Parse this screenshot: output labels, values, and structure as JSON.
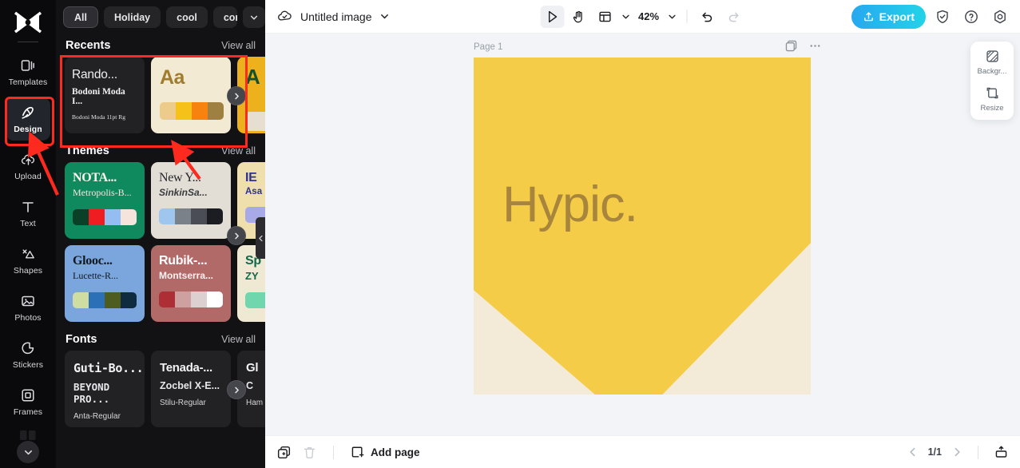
{
  "sidebar": {
    "logo_icon": "capcut-logo-icon",
    "items": [
      {
        "label": "Templates",
        "icon": "templates-icon",
        "active": false
      },
      {
        "label": "Design",
        "icon": "design-icon",
        "active": true
      },
      {
        "label": "Upload",
        "icon": "upload-cloud-icon",
        "active": false
      },
      {
        "label": "Text",
        "icon": "text-icon",
        "active": false
      },
      {
        "label": "Shapes",
        "icon": "shapes-icon",
        "active": false
      },
      {
        "label": "Photos",
        "icon": "photos-icon",
        "active": false
      },
      {
        "label": "Stickers",
        "icon": "stickers-icon",
        "active": false
      },
      {
        "label": "Frames",
        "icon": "frames-icon",
        "active": false
      }
    ],
    "more_icon": "chevron-down-icon"
  },
  "panel": {
    "chips": [
      {
        "label": "All",
        "selected": true
      },
      {
        "label": "Holiday",
        "selected": false
      },
      {
        "label": "cool",
        "selected": false
      },
      {
        "label": "concise",
        "selected": false
      }
    ],
    "chips_expand_icon": "chevron-down-icon",
    "view_all_label": "View all",
    "sections": {
      "recents": {
        "title": "Recents",
        "cards": [
          {
            "kind": "dark",
            "line1": "Rando...",
            "line2": "Bodoni Moda I...",
            "line3": "Bodoni Moda 11pt Rg"
          },
          {
            "kind": "cream",
            "line1": "Aa",
            "swatches": [
              "#edcb8a",
              "#f6c21a",
              "#f7820f",
              "#9e8140"
            ]
          },
          {
            "kind": "gold",
            "line1": "A"
          }
        ]
      },
      "themes": {
        "title": "Themes",
        "cards": [
          {
            "title": "NOTA...",
            "font": "Metropolis-B...",
            "swatches": [
              "#0a3f28",
              "#ef1d22",
              "#94bdf2",
              "#f5e4dc"
            ]
          },
          {
            "title": "New Y...",
            "font": "SinkinSa...",
            "swatches": [
              "#9ec6ee",
              "#7b8188",
              "#4a4d55",
              "#1b1d22"
            ]
          },
          {
            "title": "IE",
            "font": "Asa",
            "swatches": [
              "#a7a9e8"
            ]
          },
          {
            "title": "Glooc...",
            "font": "Lucette-R...",
            "swatches": [
              "#cfdda3",
              "#2c71b8",
              "#4d5c1f",
              "#0e2b40"
            ]
          },
          {
            "title": "Rubik-...",
            "font": "Montserra...",
            "swatches": [
              "#ad2f35",
              "#cfa0a0",
              "#ddd0d0",
              "#ffffff"
            ]
          },
          {
            "title": "Sp",
            "font": "ZY",
            "swatches": [
              "#6fd6ae"
            ]
          }
        ]
      },
      "fonts": {
        "title": "Fonts",
        "cards": [
          {
            "line1": "Guti-Bo...",
            "line2": "BEYOND PRO...",
            "line3": "Anta-Regular",
            "mono": true
          },
          {
            "line1": "Tenada-...",
            "line2": "Zocbel X-E...",
            "line3": "Stilu-Regular",
            "mono": false
          },
          {
            "line1": "Gl",
            "line2": "C",
            "line3": "Ham",
            "mono": false
          }
        ]
      }
    },
    "carousel_next_icon": "chevron-right-icon",
    "collapse_handle_icon": "chevron-left-icon"
  },
  "topbar": {
    "cloud_icon": "cloud-saved-icon",
    "document_title": "Untitled image",
    "title_caret_icon": "chevron-down-icon",
    "tools": [
      {
        "name": "select-tool",
        "icon": "cursor-arrow-icon",
        "selected": true
      },
      {
        "name": "hand-tool",
        "icon": "hand-icon",
        "selected": false
      },
      {
        "name": "layout-tool",
        "icon": "layout-panel-icon",
        "selected": false
      }
    ],
    "layout_caret_icon": "chevron-down-icon",
    "zoom_value": "42%",
    "zoom_caret_icon": "chevron-down-icon",
    "undo_icon": "undo-icon",
    "redo_icon": "redo-icon",
    "export_label": "Export",
    "export_icon": "export-upload-icon",
    "export_color": "#22b6ec",
    "shield_icon": "shield-check-icon",
    "help_icon": "question-circle-icon",
    "settings_icon": "gear-icon"
  },
  "stage": {
    "page_label": "Page 1",
    "duplicate_icon": "duplicate-page-icon",
    "more_icon": "more-horizontal-icon",
    "canvas": {
      "text": "Hypic.",
      "text_color": "#a8853d",
      "shape_color": "#f5cc47",
      "background_color": "#f3ebd7"
    }
  },
  "right_panel": {
    "items": [
      {
        "label": "Backgr...",
        "icon": "background-pattern-icon"
      },
      {
        "label": "Resize",
        "icon": "resize-icon"
      }
    ]
  },
  "bottombar": {
    "duplicate_icon": "duplicate-icon",
    "delete_icon": "trash-icon",
    "add_page_label": "Add page",
    "add_page_icon": "add-page-icon",
    "prev_icon": "chevron-left-icon",
    "page_indicator": "1/1",
    "next_icon": "chevron-right-icon",
    "present_icon": "present-icon"
  }
}
